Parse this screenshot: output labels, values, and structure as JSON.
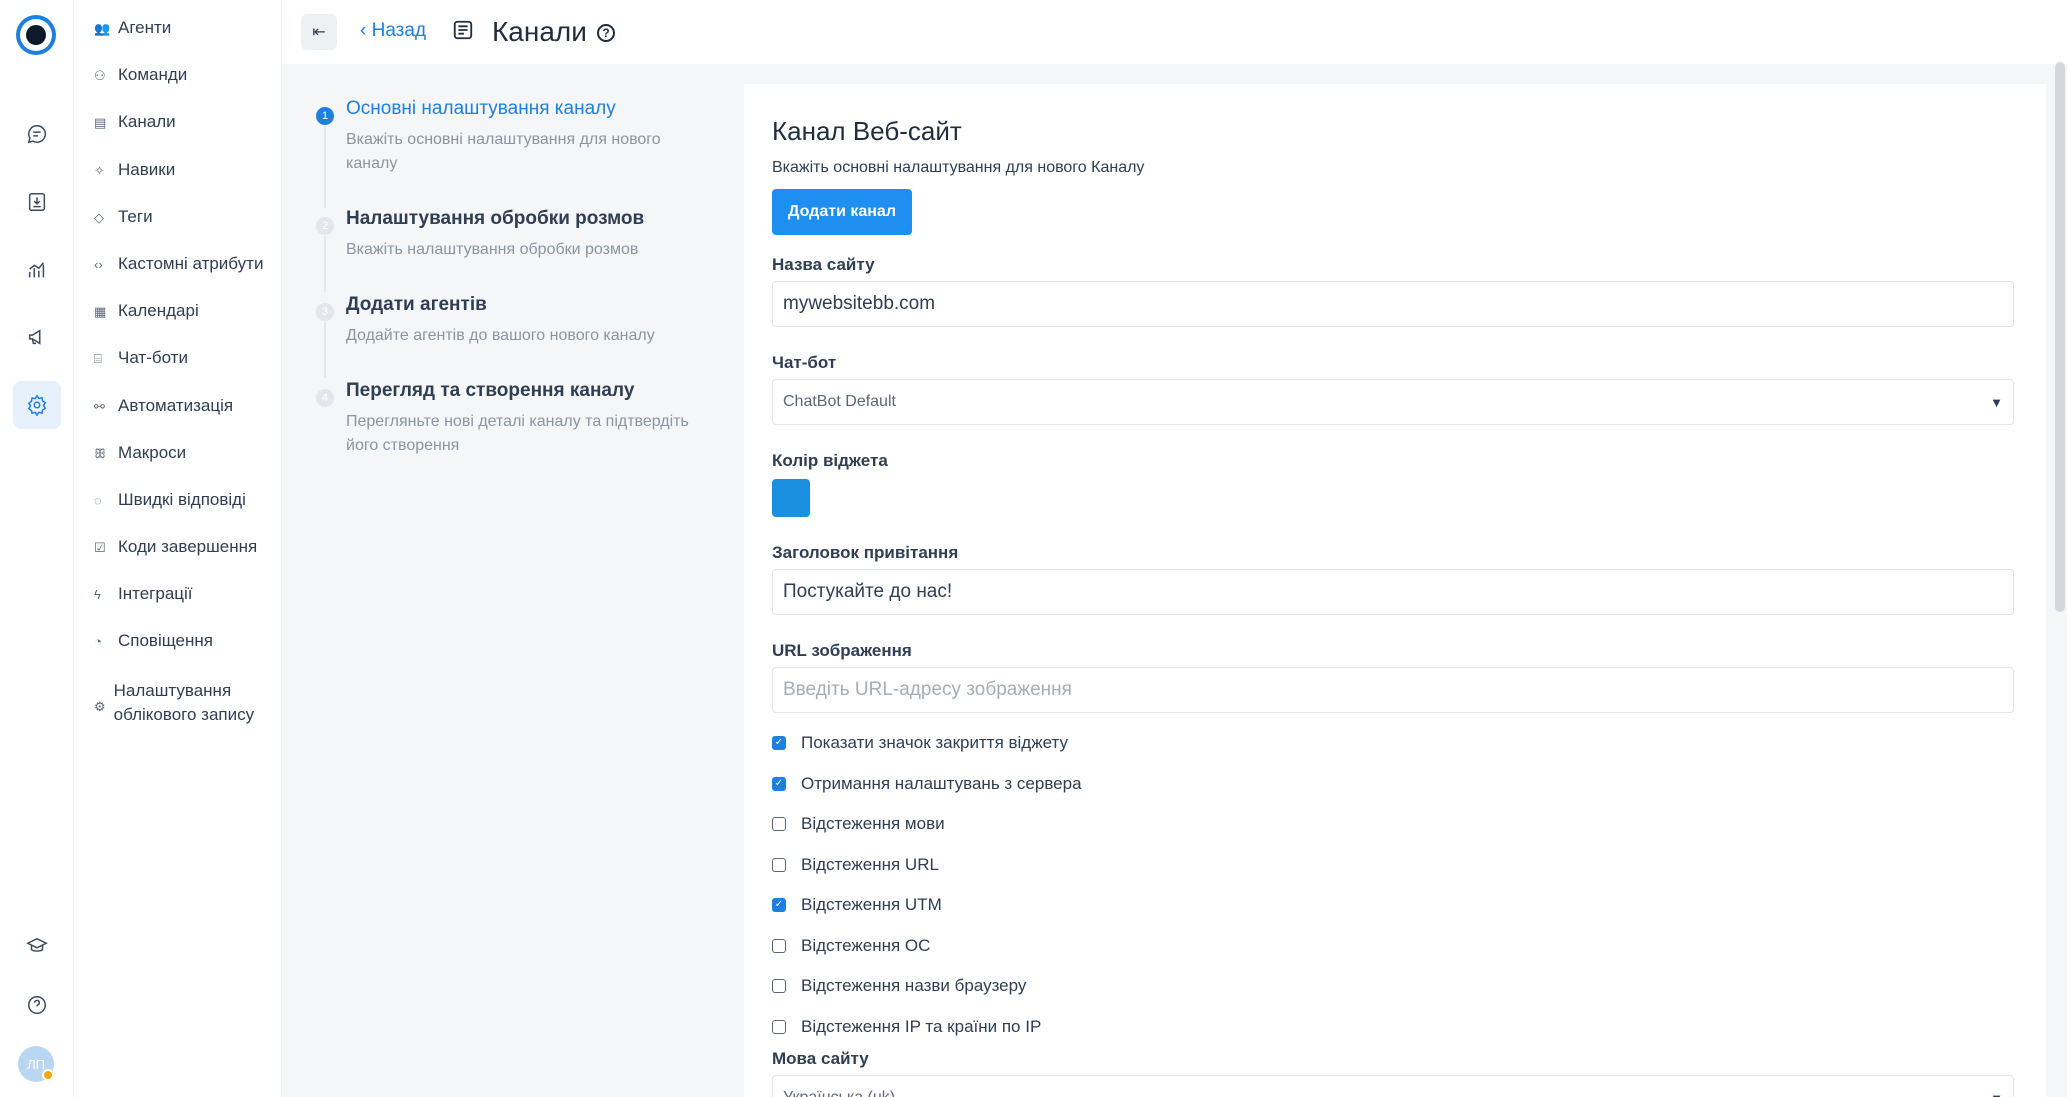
{
  "app": {
    "avatar_initials": "ЛП",
    "rail_icons": [
      "conversations-icon",
      "inbox-icon",
      "reports-icon",
      "campaigns-icon",
      "settings-icon",
      "academy-icon",
      "help-icon"
    ]
  },
  "menu": {
    "items": [
      {
        "icon": "👥",
        "label": "Агенти"
      },
      {
        "icon": "⚇",
        "label": "Команди"
      },
      {
        "icon": "▤",
        "label": "Канали"
      },
      {
        "icon": "✧",
        "label": "Навики"
      },
      {
        "icon": "◇",
        "label": "Теги"
      },
      {
        "icon": "‹›",
        "label": "Кастомні атрибути"
      },
      {
        "icon": "▦",
        "label": "Календарі"
      },
      {
        "icon": "⌸",
        "label": "Чат-боти"
      },
      {
        "icon": "⚯",
        "label": "Автоматизація"
      },
      {
        "icon": "ꕥ",
        "label": "Макроси"
      },
      {
        "icon": "◌",
        "label": "Швидкі відповіді"
      },
      {
        "icon": "☑",
        "label": "Коди завершення"
      },
      {
        "icon": "ϟ",
        "label": "Інтеграції"
      },
      {
        "icon": "◔",
        "label": "Сповіщення"
      },
      {
        "icon": "⚙",
        "label": "Налаштування облікового запису"
      }
    ]
  },
  "header": {
    "collapse_glyph": "⇤",
    "back_label": "Назад",
    "title": "Канали"
  },
  "wizard": {
    "steps": [
      {
        "num": "1",
        "title": "Основні налаштування каналу",
        "desc": "Вкажіть основні налаштування для нового каналу"
      },
      {
        "num": "2",
        "title": "Налаштування обробки розмов",
        "desc": "Вкажіть налаштування обробки розмов"
      },
      {
        "num": "3",
        "title": "Додати агентів",
        "desc": "Додайте агентів до вашого нового каналу"
      },
      {
        "num": "4",
        "title": "Перегляд та створення каналу",
        "desc": "Перегляньте нові деталі каналу та підтвердіть його створення"
      }
    ]
  },
  "form": {
    "title": "Канал Веб-сайт",
    "subtitle": "Вкажіть основні налаштування для нового Каналу",
    "add_button": "Додати канал",
    "site_name_label": "Назва сайту",
    "site_name_value": "mywebsitebb.com",
    "chatbot_label": "Чат-бот",
    "chatbot_value": "ChatBot Default",
    "widget_color_label": "Колір віджета",
    "widget_color": "#1a8fdf",
    "greeting_label": "Заголовок привітання",
    "greeting_value": "Постукайте до нас!",
    "image_url_label": "URL зображення",
    "image_url_placeholder": "Введіть URL-адресу зображення",
    "checkboxes": [
      {
        "label": "Показати значок закриття віджету",
        "checked": true
      },
      {
        "label": "Отримання налаштувань з сервера",
        "checked": true
      },
      {
        "label": "Відстеження мови",
        "checked": false
      },
      {
        "label": "Відстеження URL",
        "checked": false
      },
      {
        "label": "Відстеження UTM",
        "checked": true
      },
      {
        "label": "Відстеження ОС",
        "checked": false
      },
      {
        "label": "Відстеження назви браузеру",
        "checked": false
      },
      {
        "label": "Відстеження IP та країни по IP",
        "checked": false
      }
    ],
    "language_label": "Мова сайту",
    "language_value": "Українська (uk)"
  }
}
